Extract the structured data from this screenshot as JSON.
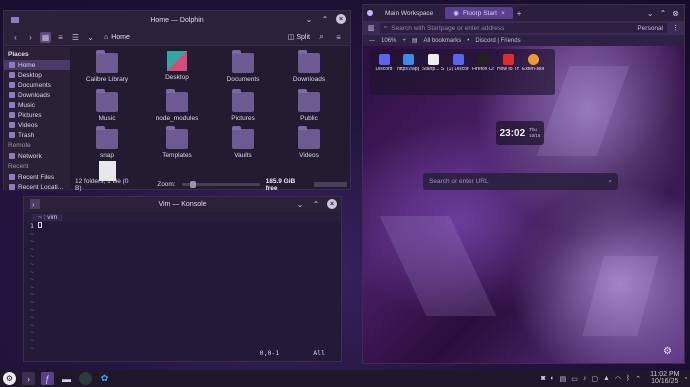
{
  "colors": {
    "accent": "#5c3e8e",
    "panel": "#231b30",
    "taskbar": "#1e1829"
  },
  "dolphin": {
    "title": "Home — Dolphin",
    "location": "Home",
    "split_label": "Split",
    "places_header": "Places",
    "places": [
      "Home",
      "Desktop",
      "Documents",
      "Downloads",
      "Music",
      "Pictures",
      "Videos",
      "Trash"
    ],
    "remote_header": "Remote",
    "remote_items": [
      "Network"
    ],
    "recent_header": "Recent",
    "recent_items": [
      "Recent Files",
      "Recent Locati..."
    ],
    "files": [
      "Calibre Library",
      "Desktop",
      "Documents",
      "Downloads",
      "Music",
      "node_modules",
      "Pictures",
      "Public",
      "snap",
      "Templates",
      "Vaults",
      "Videos",
      ""
    ],
    "status_text": "12 folders, 1 file (0 B)",
    "zoom_label": "Zoom:",
    "free_space": "185.9 GiB free"
  },
  "konsole": {
    "title": "Vim — Konsole",
    "tab_label": "~ : vim",
    "line1_no": "1",
    "position": "0,0-1",
    "scroll": "All"
  },
  "browser": {
    "tab1": "Main Workspace",
    "tab2": "Floorp Start",
    "url_placeholder": "Search with Startpage or enter address",
    "persona": "Personal",
    "zoom": "106%",
    "bookmarks_label": "All bookmarks",
    "bookmark_item": "Discord | Friends",
    "shortcuts": [
      "Discord",
      "https://app.ro...",
      "Startp... Search",
      "(1) Discord | Fri...",
      "Firefox Color",
      "How to Theme Kons...",
      "Exten-sions"
    ],
    "clock_time": "23:02",
    "clock_day": "Thu",
    "clock_date": "10/16",
    "search_placeholder": "Search or enter URL"
  },
  "taskbar": {
    "time": "11:02 PM",
    "date": "10/16/25"
  }
}
